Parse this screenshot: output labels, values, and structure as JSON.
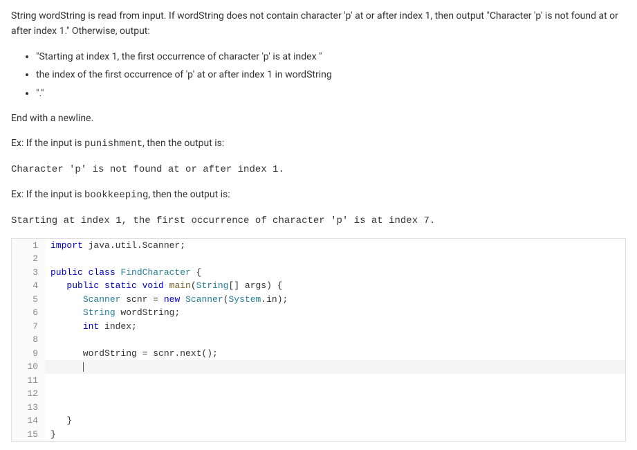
{
  "problem": {
    "para1": "String wordString is read from input. If wordString does not contain character 'p' at or after index 1, then output \"Character 'p' is not found at or after index 1.\" Otherwise, output:",
    "bullets": [
      "\"Starting at index 1, the first occurrence of character 'p' is at index \"",
      "the index of the first occurrence of 'p' at or after index 1 in wordString",
      "\".\""
    ],
    "para2": "End with a newline.",
    "ex1_prefix": "Ex: If the input is ",
    "ex1_input": "punishment",
    "ex1_suffix": ", then the output is:",
    "ex1_output": "Character 'p' is not found at or after index 1.",
    "ex2_prefix": "Ex: If the input is ",
    "ex2_input": "bookkeeping",
    "ex2_suffix": ", then the output is:",
    "ex2_output": "Starting at index 1, the first occurrence of character 'p' is at index 7."
  },
  "code": {
    "lines": [
      {
        "n": 1,
        "tokens": [
          {
            "t": "import ",
            "c": "kw"
          },
          {
            "t": "java.util.Scanner;",
            "c": "ident"
          }
        ]
      },
      {
        "n": 2,
        "tokens": []
      },
      {
        "n": 3,
        "tokens": [
          {
            "t": "public class ",
            "c": "kw"
          },
          {
            "t": "FindCharacter",
            "c": "typ"
          },
          {
            "t": " {",
            "c": "ident"
          }
        ]
      },
      {
        "n": 4,
        "tokens": [
          {
            "t": "   ",
            "c": ""
          },
          {
            "t": "public static void ",
            "c": "kw"
          },
          {
            "t": "main",
            "c": "fn"
          },
          {
            "t": "(",
            "c": "ident"
          },
          {
            "t": "String",
            "c": "typ"
          },
          {
            "t": "[] args) {",
            "c": "ident"
          }
        ]
      },
      {
        "n": 5,
        "tokens": [
          {
            "t": "      ",
            "c": ""
          },
          {
            "t": "Scanner",
            "c": "typ"
          },
          {
            "t": " scnr = ",
            "c": "ident"
          },
          {
            "t": "new ",
            "c": "kw"
          },
          {
            "t": "Scanner",
            "c": "typ"
          },
          {
            "t": "(",
            "c": "ident"
          },
          {
            "t": "System",
            "c": "typ"
          },
          {
            "t": ".in);",
            "c": "ident"
          }
        ]
      },
      {
        "n": 6,
        "tokens": [
          {
            "t": "      ",
            "c": ""
          },
          {
            "t": "String",
            "c": "typ"
          },
          {
            "t": " wordString;",
            "c": "ident"
          }
        ]
      },
      {
        "n": 7,
        "tokens": [
          {
            "t": "      ",
            "c": ""
          },
          {
            "t": "int ",
            "c": "kw"
          },
          {
            "t": "index;",
            "c": "ident"
          }
        ]
      },
      {
        "n": 8,
        "tokens": []
      },
      {
        "n": 9,
        "tokens": [
          {
            "t": "      wordString = scnr.next();",
            "c": "ident"
          }
        ]
      },
      {
        "n": 10,
        "tokens": [
          {
            "t": "      ",
            "c": ""
          }
        ],
        "highlighted": true,
        "cursor": true
      },
      {
        "n": 11,
        "tokens": []
      },
      {
        "n": 12,
        "tokens": []
      },
      {
        "n": 13,
        "tokens": []
      },
      {
        "n": 14,
        "tokens": [
          {
            "t": "   }",
            "c": "ident"
          }
        ]
      },
      {
        "n": 15,
        "tokens": [
          {
            "t": "}",
            "c": "ident"
          }
        ]
      }
    ]
  }
}
